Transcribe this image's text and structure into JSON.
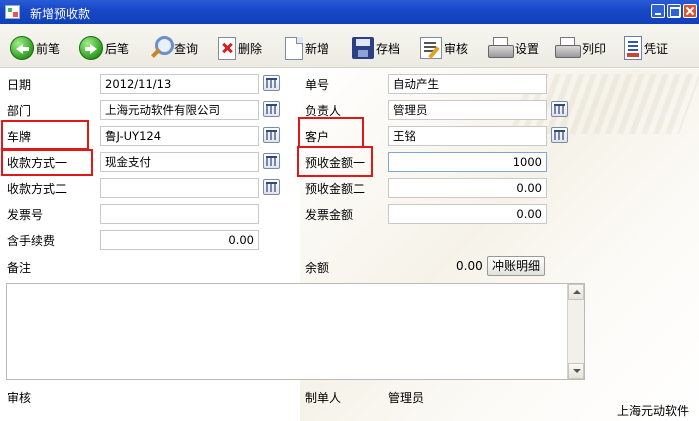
{
  "window": {
    "title": "新增预收款"
  },
  "toolbar": {
    "prev": "前笔",
    "next": "后笔",
    "query": "查询",
    "delete": "删除",
    "new": "新增",
    "save": "存档",
    "audit": "审核",
    "settings": "设置",
    "print": "列印",
    "voucher": "凭证"
  },
  "form": {
    "date_label": "日期",
    "date_value": "2012/11/13",
    "order_no_label": "单号",
    "order_no_value": "自动产生",
    "dept_label": "部门",
    "dept_value": "上海元动软件有限公司",
    "manager_label": "负责人",
    "manager_value": "管理员",
    "plate_label": "车牌",
    "plate_value": "鲁J-UY124",
    "customer_label": "客户",
    "customer_value": "王铭",
    "pay1_label": "收款方式一",
    "pay1_value": "现金支付",
    "amount1_label": "预收金额一",
    "amount1_value": "1000",
    "pay2_label": "收款方式二",
    "pay2_value": "",
    "amount2_label": "预收金额二",
    "amount2_value": "0.00",
    "invoice_no_label": "发票号",
    "invoice_no_value": "",
    "invoice_amount_label": "发票金额",
    "invoice_amount_value": "0.00",
    "fee_label": "含手续费",
    "fee_value": "0.00",
    "remark_label": "备注",
    "remark_value": "",
    "balance_label": "余额",
    "balance_value": "0.00",
    "clear_button": "冲账明细",
    "audit_label": "审核",
    "creator_label": "制单人",
    "creator_value": "管理员"
  },
  "footer": {
    "company": "上海元动软件"
  },
  "colors": {
    "titlebar": "#1848c8",
    "highlight": "#e01818"
  }
}
